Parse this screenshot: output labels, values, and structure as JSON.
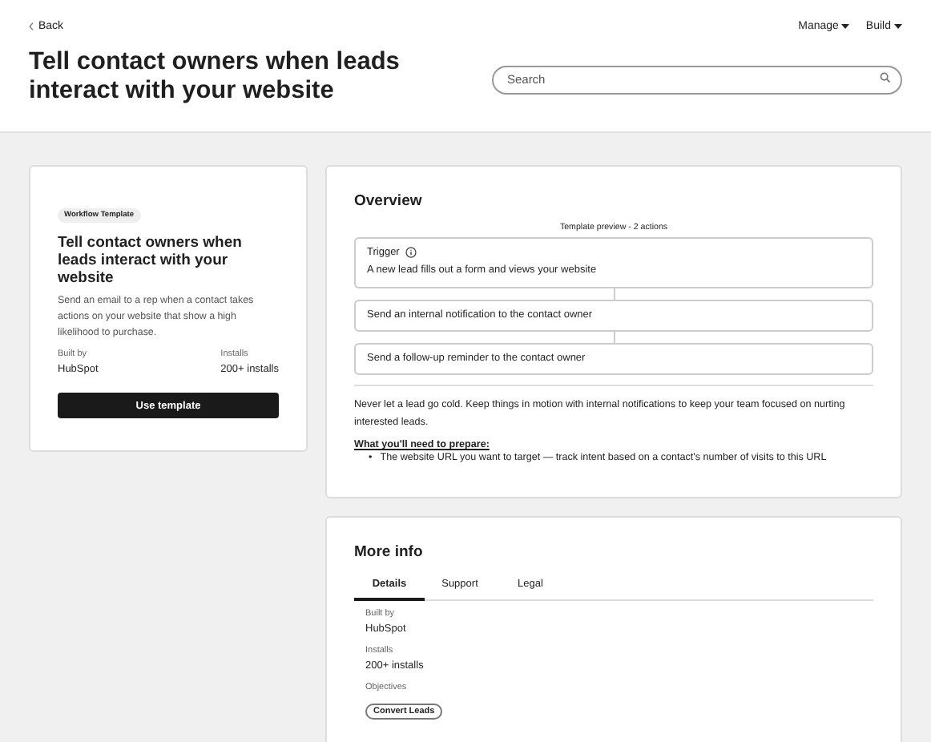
{
  "header": {
    "back": "Back",
    "menus": [
      {
        "label": "Manage"
      },
      {
        "label": "Build"
      }
    ],
    "title": "Tell contact owners when leads interact with your website",
    "search": {
      "placeholder": "Search"
    }
  },
  "summary": {
    "badge": "Workflow Template",
    "title": "Tell contact owners when leads interact with your website",
    "description": "Send an email to a rep when a contact takes actions on your website that show a high likelihood to purchase.",
    "stats": [
      {
        "label": "Built by",
        "value": "HubSpot"
      },
      {
        "label": "Installs",
        "value": "200+ installs"
      }
    ],
    "button": "Use template"
  },
  "overview": {
    "title": "Overview",
    "preview_caption": "Template preview - 2 actions",
    "steps": [
      {
        "kind": "trigger",
        "label": "Trigger",
        "text": "A new lead fills out a form and views your website"
      },
      {
        "kind": "action",
        "text": "Send an internal notification to the contact owner"
      },
      {
        "kind": "action",
        "text": "Send a follow-up reminder to the contact owner"
      }
    ],
    "description": "Never let a lead go cold. Keep things in motion with internal notifications to keep your team focused on nurting interested leads.",
    "prepare_heading": "What you'll need to prepare:",
    "prepare_items": [
      {
        "marker": "•",
        "text": "The website URL you want to target — track intent based on a contact's number of visits to this URL"
      }
    ]
  },
  "more_info": {
    "title": "More info",
    "tabs": [
      {
        "label": "Details",
        "selected": true
      },
      {
        "label": "Support",
        "selected": false
      },
      {
        "label": "Legal",
        "selected": false
      }
    ],
    "fields": [
      {
        "label": "Built by",
        "value": "HubSpot"
      },
      {
        "label": "Installs",
        "value": "200+ installs"
      }
    ],
    "objectives_label": "Objectives",
    "objectives": [
      "Convert Leads"
    ]
  }
}
